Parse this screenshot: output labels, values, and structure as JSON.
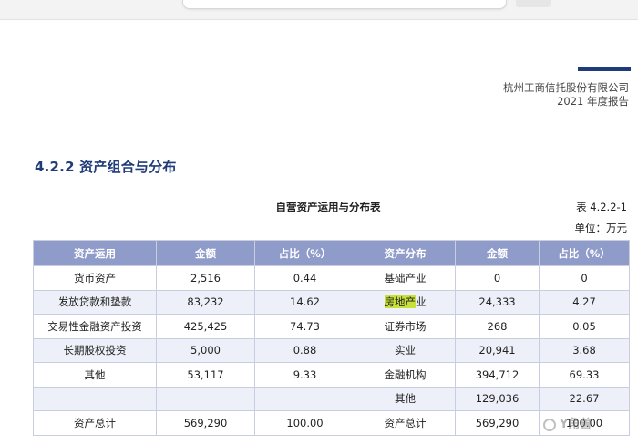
{
  "header": {
    "company": "杭州工商信托股份有限公司",
    "report": "2021 年度报告"
  },
  "section": {
    "heading": "4.2.2 资产组合与分布"
  },
  "table": {
    "title": "自营资产运用与分布表",
    "number": "表 4.2.2-1",
    "unit": "单位：万元",
    "columns": [
      "资产运用",
      "金额",
      "占比（%）",
      "资产分布",
      "金额",
      "占比（%）"
    ],
    "rows": [
      {
        "use": "货币资产",
        "use_amount": "2,516",
        "use_pct": "0.44",
        "dist": "基础产业",
        "dist_amount": "0",
        "dist_pct": "0"
      },
      {
        "use": "发放贷款和垫款",
        "use_amount": "83,232",
        "use_pct": "14.62",
        "dist": "房地产业",
        "dist_amount": "24,333",
        "dist_pct": "4.27"
      },
      {
        "use": "交易性金融资产投资",
        "use_amount": "425,425",
        "use_pct": "74.73",
        "dist": "证券市场",
        "dist_amount": "268",
        "dist_pct": "0.05"
      },
      {
        "use": "长期股权投资",
        "use_amount": "5,000",
        "use_pct": "0.88",
        "dist": "实业",
        "dist_amount": "20,941",
        "dist_pct": "3.68"
      },
      {
        "use": "其他",
        "use_amount": "53,117",
        "use_pct": "9.33",
        "dist": "金融机构",
        "dist_amount": "394,712",
        "dist_pct": "69.33"
      },
      {
        "use": "",
        "use_amount": "",
        "use_pct": "",
        "dist": "其他",
        "dist_amount": "129,036",
        "dist_pct": "22.67"
      },
      {
        "use": "资产总计",
        "use_amount": "569,290",
        "use_pct": "100.00",
        "dist": "资产总计",
        "dist_amount": "569,290",
        "dist_pct": "100.00"
      }
    ],
    "highlight_text": "房地产",
    "highlight_rest": "业"
  },
  "watermark": {
    "text": "Y角兽"
  },
  "colors": {
    "accent": "#1f3b7a",
    "header_bg": "#8f9bc9",
    "stripe": "#edf0f8",
    "highlight": "#c8e03a"
  }
}
